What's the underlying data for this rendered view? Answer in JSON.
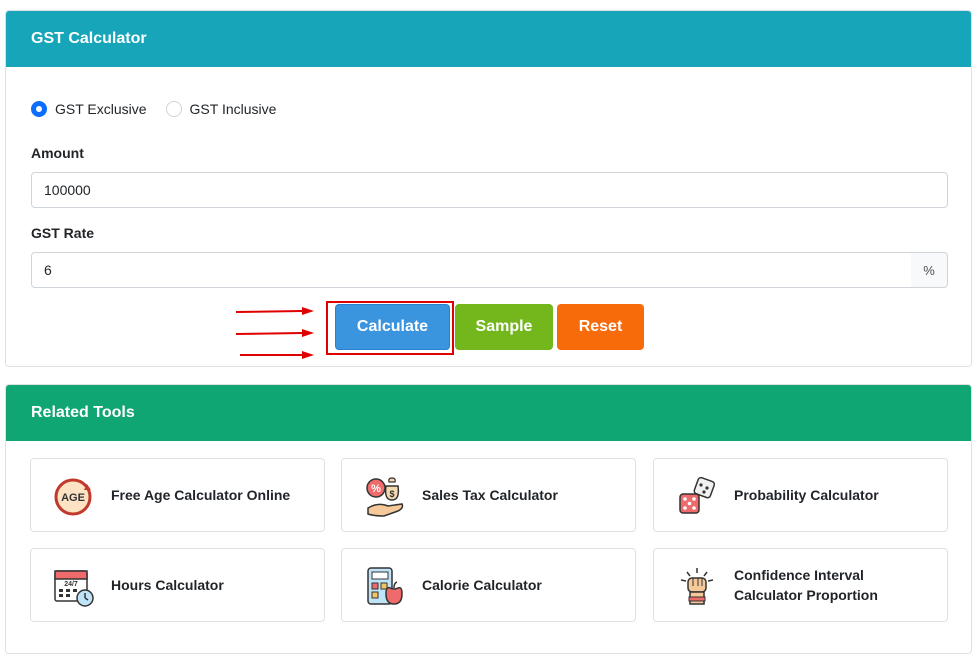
{
  "calculator": {
    "title": "GST Calculator",
    "radio_options": [
      {
        "label": "GST Exclusive",
        "checked": true
      },
      {
        "label": "GST Inclusive",
        "checked": false
      }
    ],
    "amount": {
      "label": "Amount",
      "value": "100000"
    },
    "gst_rate": {
      "label": "GST Rate",
      "value": "6",
      "suffix": "%"
    },
    "buttons": {
      "calculate": {
        "label": "Calculate",
        "color": "#3b95de"
      },
      "sample": {
        "label": "Sample",
        "color": "#74b71d"
      },
      "reset": {
        "label": "Reset",
        "color": "#f76b0a"
      }
    },
    "annotation_color": "#e00000"
  },
  "related_tools": {
    "title": "Related Tools",
    "items": [
      {
        "label": "Free Age Calculator Online",
        "icon": "age-icon"
      },
      {
        "label": "Sales Tax Calculator",
        "icon": "sales-tax-icon"
      },
      {
        "label": "Probability Calculator",
        "icon": "dice-icon"
      },
      {
        "label": "Hours Calculator",
        "icon": "calendar-clock-icon"
      },
      {
        "label": "Calorie Calculator",
        "icon": "calculator-apple-icon"
      },
      {
        "label": "Confidence Interval Calculator Proportion",
        "icon": "fist-icon"
      }
    ]
  }
}
